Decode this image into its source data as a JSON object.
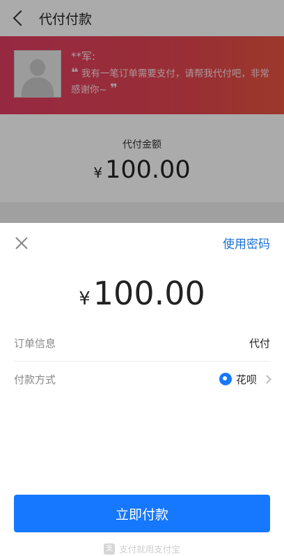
{
  "background": {
    "header": {
      "title": "代付付款"
    },
    "banner": {
      "name": "**军:",
      "quote_open": "❝",
      "quote_text": "我有一笔订单需要支付，请帮我代付吧，非常感谢你~",
      "quote_close": "❞"
    },
    "amount_card": {
      "label": "代付金额",
      "currency": "¥",
      "amount": "100.00"
    }
  },
  "sheet": {
    "use_password": "使用密码",
    "currency": "¥",
    "amount": "100.00",
    "order_info_label": "订单信息",
    "order_info_value": "代付",
    "pay_method_label": "付款方式",
    "pay_method_value": "花呗",
    "pay_button": "立即付款",
    "footer_logo": "支",
    "footer_text": "支付就用支付宝"
  },
  "colors": {
    "accent": "#1677ff",
    "banner": "#e23d63"
  },
  "icons": [
    "back-icon",
    "close-icon",
    "huabei-icon",
    "chevron-right-icon",
    "alipay-logo-icon"
  ]
}
